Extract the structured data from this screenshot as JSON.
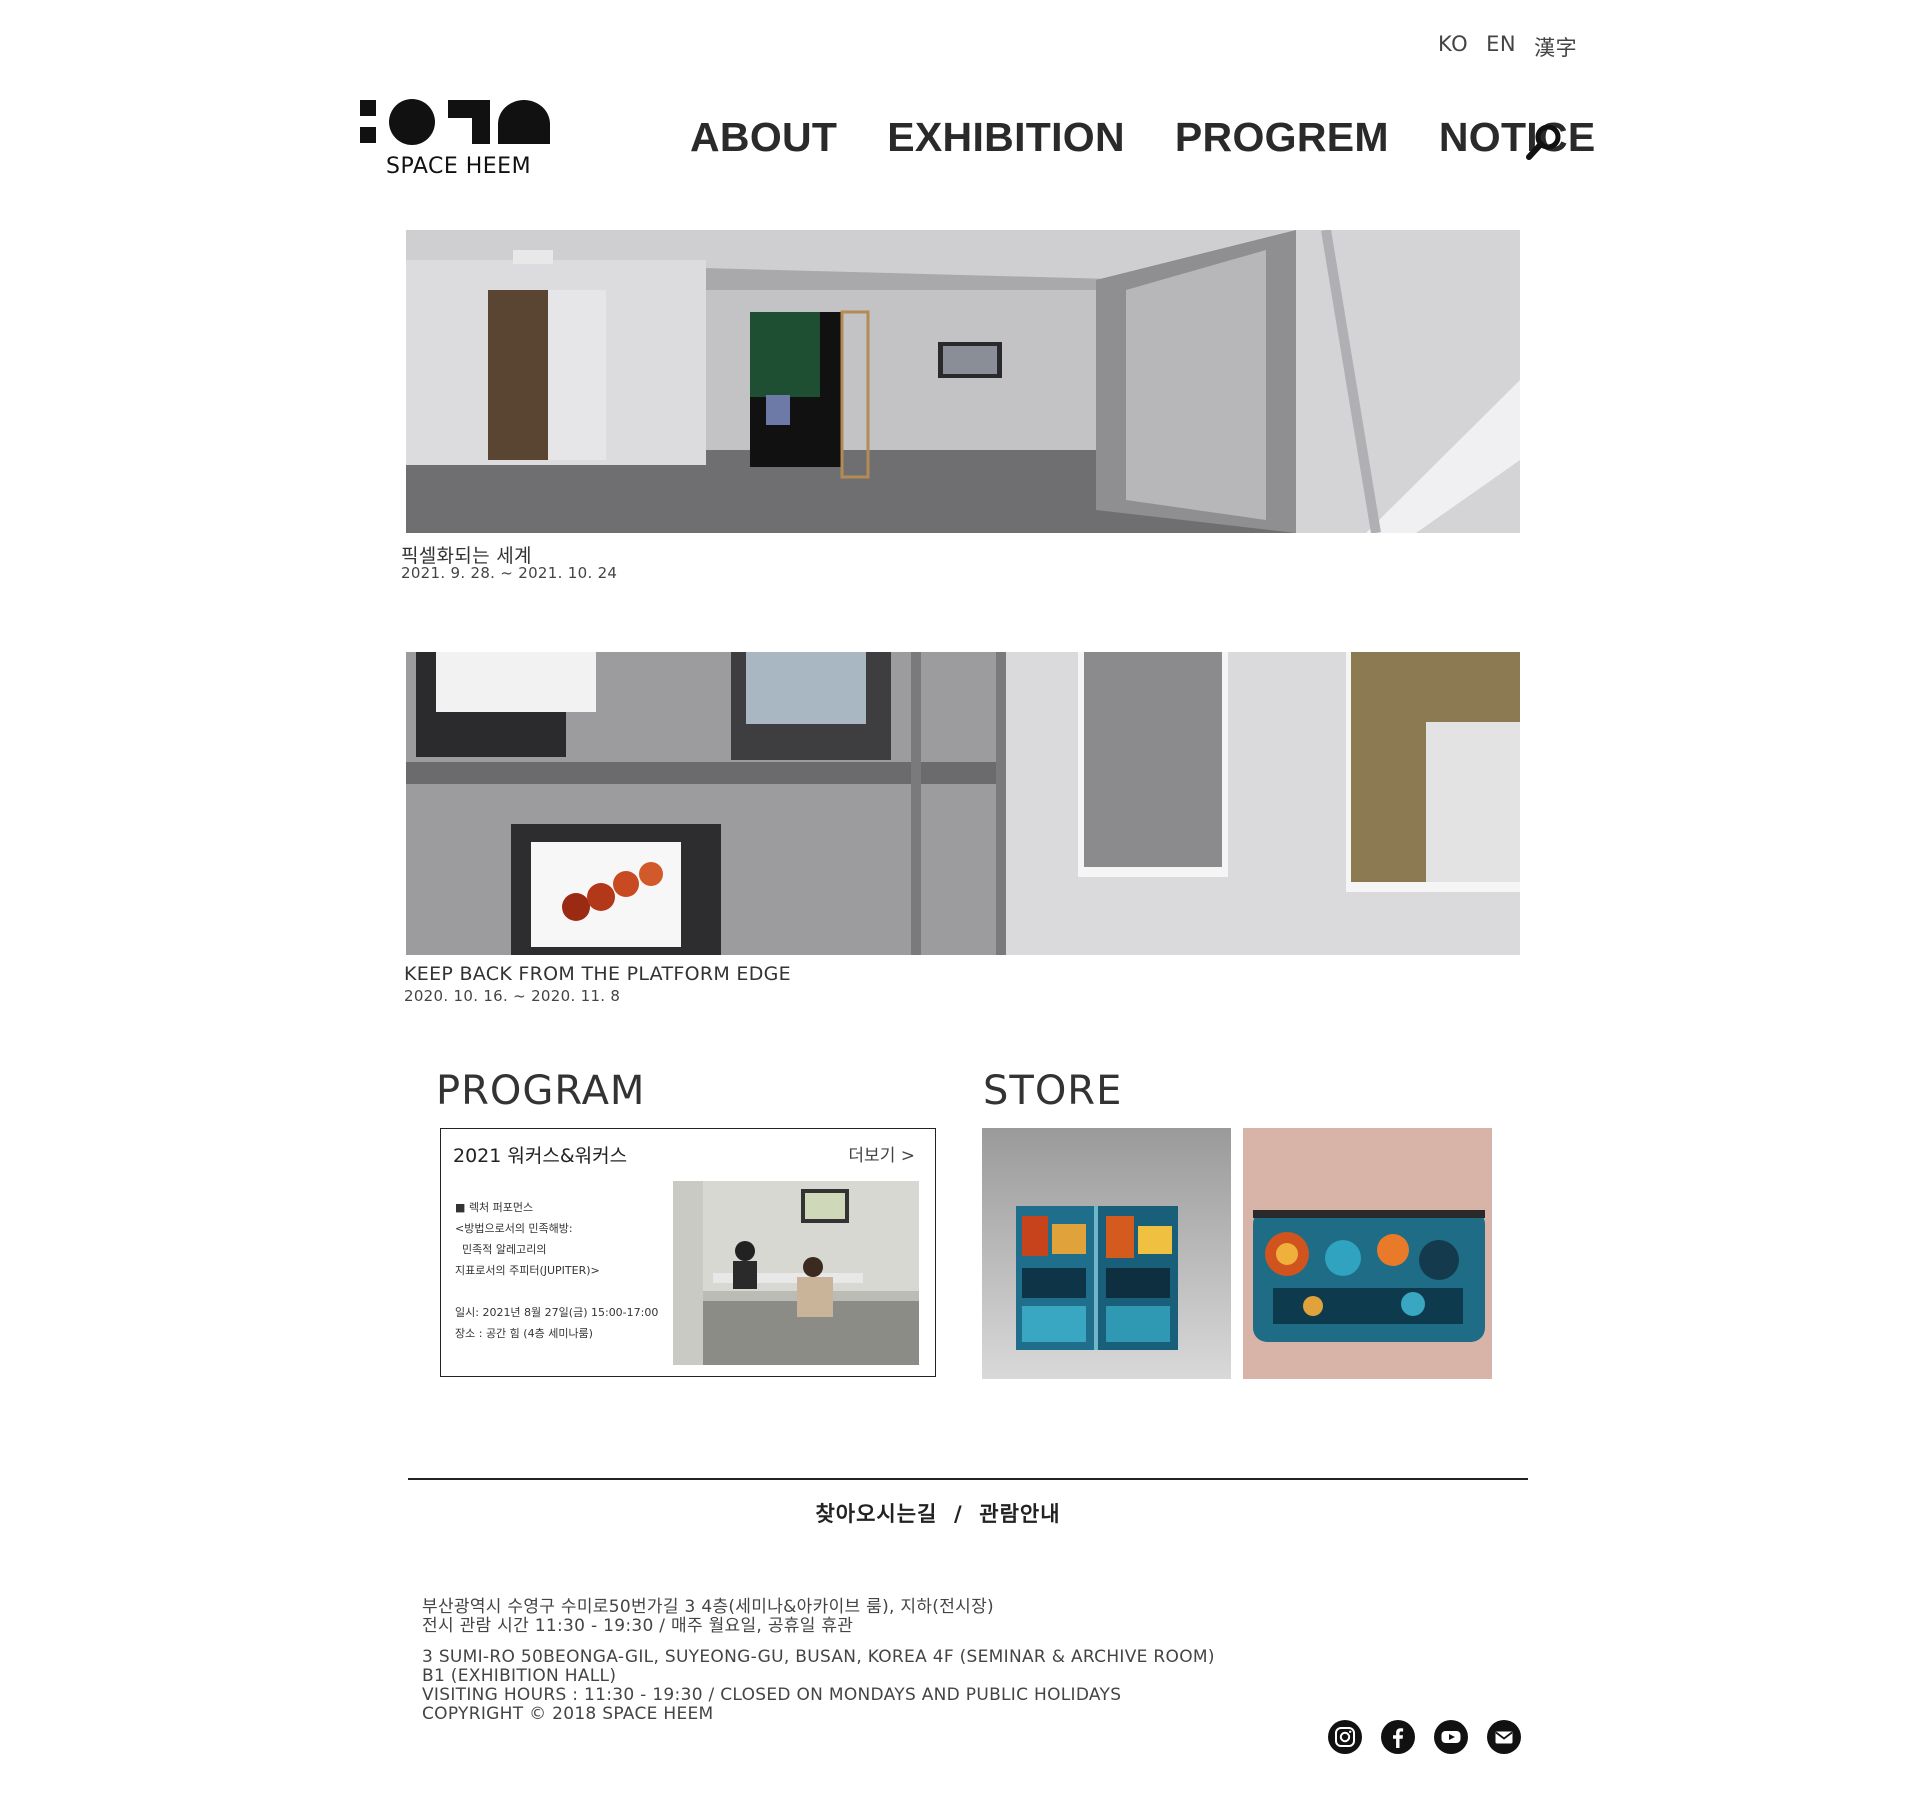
{
  "lang": [
    "KO",
    "EN",
    "漢字"
  ],
  "logo": {
    "text": "SPACE HEEM"
  },
  "nav": [
    "ABOUT",
    "EXHIBITION",
    "PROGREM",
    "NOTICE"
  ],
  "exhibitions": [
    {
      "title": "픽셀화되는 세계",
      "date": "2021. 9. 28. ~ 2021. 10. 24"
    },
    {
      "title": "KEEP BACK FROM THE PLATFORM EDGE",
      "date": "2020. 10. 16. ~ 2020. 11. 8"
    }
  ],
  "program": {
    "heading": "PROGRAM",
    "card_title": "2021 워커스&워커스",
    "more": "더보기 >",
    "desc": [
      "■ 렉처 퍼포먼스",
      "<방법으로서의 민족해방:",
      "  민족적 알레고리의",
      "지표로서의 주피터(JUPITER)>",
      "",
      "일시: 2021년 8월 27일(금) 15:00-17:00",
      "장소 : 공간 힘 (4층 세미나룸)"
    ]
  },
  "store": {
    "heading": "STORE"
  },
  "footer": {
    "visit_title": "찾아오시는길  /  관람안내",
    "address_ko": "부산광역시 수영구 수미로50번가길 3 4층(세미나&아카이브 룸), 지하(전시장)",
    "hours_ko": "전시 관람 시간 11:30 - 19:30 / 매주 월요일, 공휴일 휴관",
    "address_en_1": "3 SUMI-RO 50BEONGA-GIL, SUYEONG-GU, BUSAN, KOREA 4F (SEMINAR & ARCHIVE ROOM)",
    "address_en_2": "B1 (EXHIBITION HALL)",
    "hours_en": "VISITING HOURS : 11:30 - 19:30 / CLOSED ON MONDAYS AND PUBLIC HOLIDAYS",
    "copyright": "COPYRIGHT © 2018 SPACE HEEM"
  },
  "social": [
    "instagram-icon",
    "facebook-icon",
    "youtube-icon",
    "mail-icon"
  ]
}
